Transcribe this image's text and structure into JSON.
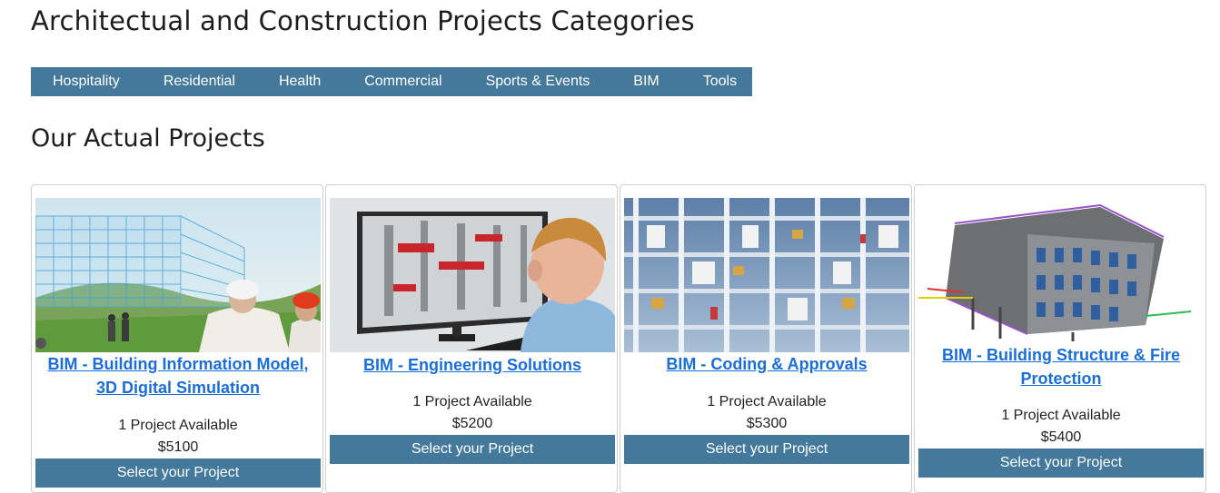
{
  "page_title": "Architectual and Construction Projects Categories",
  "categories": [
    {
      "label": "Hospitality"
    },
    {
      "label": "Residential"
    },
    {
      "label": "Health"
    },
    {
      "label": "Commercial"
    },
    {
      "label": "Sports & Events"
    },
    {
      "label": "BIM"
    },
    {
      "label": "Tools"
    }
  ],
  "section_title": "Our Actual Projects",
  "projects": [
    {
      "title": "BIM - Building Information Model, 3D Digital Simulation",
      "availability": "1 Project Available",
      "price": "$5100",
      "button": "Select your Project",
      "image": "wireframe-building-with-engineers"
    },
    {
      "title": "BIM - Engineering Solutions",
      "availability": "1 Project Available",
      "price": "$5200",
      "button": "Select your Project",
      "image": "engineer-at-computer-monitor"
    },
    {
      "title": "BIM - Coding & Approvals",
      "availability": "1 Project Available",
      "price": "$5300",
      "button": "Select your Project",
      "image": "building-services-mep-model"
    },
    {
      "title": "BIM - Building Structure & Fire Protection",
      "availability": "1 Project Available",
      "price": "$5400",
      "button": "Select your Project",
      "image": "structural-bim-model"
    }
  ],
  "colors": {
    "accent": "#44799c",
    "link": "#1a6ed8"
  }
}
